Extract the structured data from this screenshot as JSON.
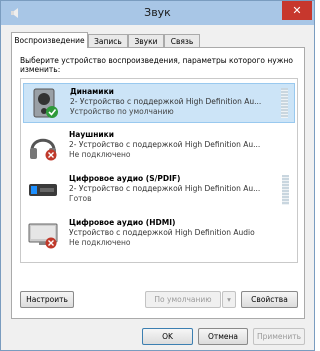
{
  "window": {
    "title": "Звук"
  },
  "tabs": [
    {
      "label": "Воспроизведение"
    },
    {
      "label": "Запись"
    },
    {
      "label": "Звуки"
    },
    {
      "label": "Связь"
    }
  ],
  "instruction": "Выберите устройство воспроизведения, параметры которого нужно изменить:",
  "devices": [
    {
      "name": "Динамики",
      "description": "2- Устройство с поддержкой High Definition Au...",
      "status": "Устройство по умолчанию",
      "icon": "speakers-icon"
    },
    {
      "name": "Наушники",
      "description": "2- Устройство с поддержкой High Definition Au...",
      "status": "Не подключено",
      "icon": "headphones-icon"
    },
    {
      "name": "Цифровое аудио (S/PDIF)",
      "description": "2- Устройство с поддержкой High Definition Au...",
      "status": "Готов",
      "icon": "spdif-icon"
    },
    {
      "name": "Цифровое аудио (HDMI)",
      "description": "Устройство с поддержкой High Definition Audio",
      "status": "Не подключено",
      "icon": "hdmi-display-icon"
    }
  ],
  "buttons": {
    "configure": "Настроить",
    "default": "По умолчанию",
    "properties": "Свойства",
    "ok": "OK",
    "cancel": "Отмена",
    "apply": "Применить"
  }
}
